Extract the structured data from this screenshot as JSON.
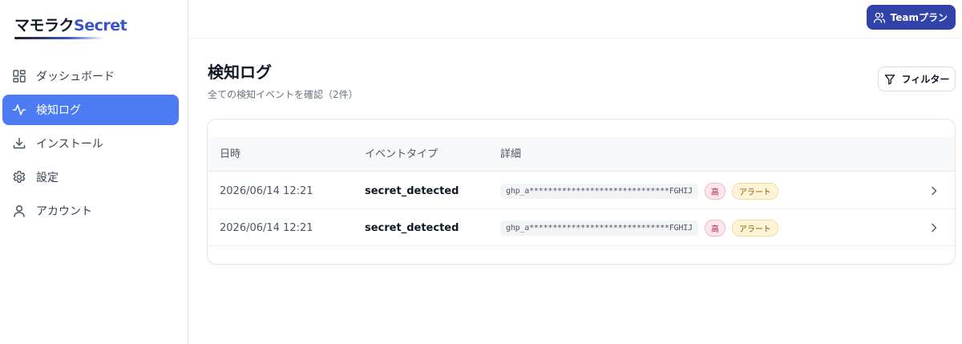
{
  "app": {
    "logo_jp": "マモラク",
    "logo_en": "Secret"
  },
  "sidebar": {
    "items": [
      {
        "label": "ダッシュボード",
        "icon": "dashboard-grid-icon",
        "active": false
      },
      {
        "label": "検知ログ",
        "icon": "activity-pulse-icon",
        "active": true
      },
      {
        "label": "インストール",
        "icon": "download-icon",
        "active": false
      },
      {
        "label": "設定",
        "icon": "gear-icon",
        "active": false
      },
      {
        "label": "アカウント",
        "icon": "user-icon",
        "active": false
      }
    ]
  },
  "header": {
    "plan_button": "Teamプラン",
    "plan_icon": "users-icon"
  },
  "main": {
    "title": "検知ログ",
    "subtitle": "全ての検知イベントを確認（2件）",
    "filter_button": "フィルター",
    "filter_icon": "filter-funnel-icon"
  },
  "table": {
    "columns": [
      "日時",
      "イベントタイプ",
      "詳細"
    ],
    "rows": [
      {
        "datetime": "2026/06/14 12:21",
        "event_type": "secret_detected",
        "masked_value": "ghp_a******************************FGHIJ",
        "severity": "高",
        "status": "アラート"
      },
      {
        "datetime": "2026/06/14 12:21",
        "event_type": "secret_detected",
        "masked_value": "ghp_a******************************FGHIJ",
        "severity": "高",
        "status": "アラート"
      }
    ]
  },
  "colors": {
    "accent": "#4d7bf3",
    "plan_button": "#3142a9",
    "severity_high": "#b42345",
    "status_alert": "#8a5a00"
  }
}
